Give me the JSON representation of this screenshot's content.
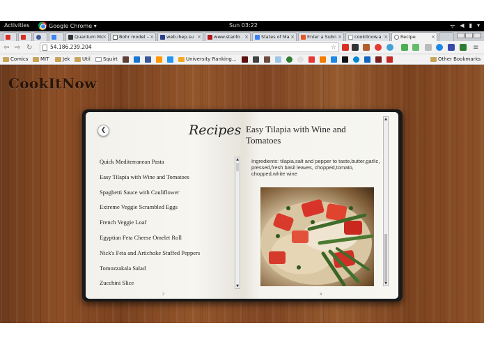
{
  "system_bar": {
    "activities": "Activities",
    "app_name": "Google Chrome ▾",
    "clock": "Sun 03:22"
  },
  "tabs": [
    {
      "label": "",
      "color": "#d93025"
    },
    {
      "label": "",
      "color": "#d93025"
    },
    {
      "label": "",
      "color": "#3d5a98"
    },
    {
      "label": "",
      "color": "#4285f4"
    },
    {
      "label": "Quantum Mc",
      "color": "#333333"
    },
    {
      "label": "Bohr model –",
      "color": "#555555"
    },
    {
      "label": "web.ihep.su",
      "color": "#2b3f8c"
    },
    {
      "label": "www.stanfo",
      "color": "#b31b1b"
    },
    {
      "label": "States of Ma",
      "color": "#3b82f6"
    },
    {
      "label": "Enter a Subn",
      "color": "#e8542a"
    },
    {
      "label": "cookitnow.a",
      "color": "#999999"
    },
    {
      "label": "Recipe",
      "color": "#777777"
    }
  ],
  "toolbar": {
    "url": "54.186.239.204"
  },
  "bookmarks": {
    "items": [
      "Comics",
      "MIT",
      "Jek",
      "Util",
      "Squirt",
      "University Ranking..."
    ],
    "other": "Other Bookmarks"
  },
  "app": {
    "brand": "CookItNow",
    "recipes_heading": "Recipes",
    "recipes": [
      "Quick Mediterranean Pasta",
      "Easy Tilapia with Wine and Tomatoes",
      "Spaghetti Sauce with Cauliflower",
      "Extreme Veggie Scrambled Eggs",
      "French Veggie Loaf",
      "Egyptian Feta Cheese Omelet Roll",
      "Nick's Feta and Artichoke Stuffed Peppers",
      "Tomozzakala Salad",
      "Zucchini Slice"
    ],
    "left_page_number": "2",
    "right_page_number": "4",
    "recipe": {
      "title": "Easy Tilapia with Wine and Tomatoes",
      "ingredients": "Ingredients: tilapia,salt and pepper to taste,butter,garlic, pressed,fresh basil leaves, chopped,tomato, chopped,white wine"
    }
  }
}
